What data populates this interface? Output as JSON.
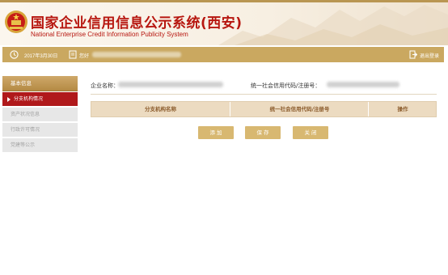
{
  "header": {
    "title_cn": "国家企业信用信息公示系统(西安)",
    "title_en": "National Enterprise Credit Information Publicity System",
    "accent_color": "#b7160f"
  },
  "topbar": {
    "date": "2017年3月30日",
    "greeting": "您好",
    "logout": "退出登录",
    "bar_color": "#caa860"
  },
  "sidebar": {
    "header": "基本信息",
    "items": [
      {
        "label": "分支机构情况",
        "active": true
      },
      {
        "label": "资产状况信息",
        "active": false
      },
      {
        "label": "行政许可情况",
        "active": false
      },
      {
        "label": "党建等公示",
        "active": false
      }
    ]
  },
  "main": {
    "company_name_label": "企业名称：",
    "credit_code_label": "统一社会信用代码/注册号：",
    "table": {
      "headers": [
        "分支机构名称",
        "统一社会信用代码/注册号",
        "操作"
      ]
    },
    "buttons": {
      "add": "添 加",
      "save": "保 存",
      "close": "关 闭"
    }
  }
}
